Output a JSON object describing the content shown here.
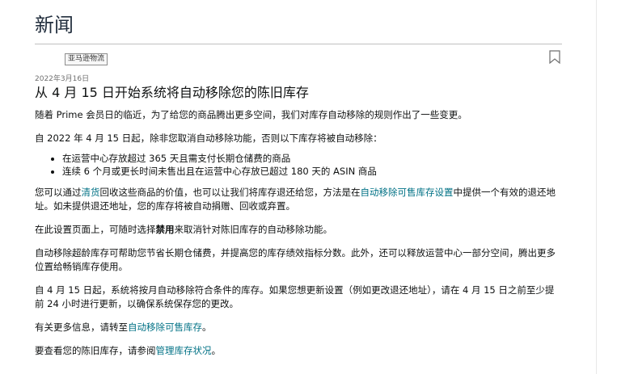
{
  "header": {
    "title": "新闻"
  },
  "article": {
    "tag": "亚马逊物流",
    "date": "2022年3月16日",
    "headline": "从 4 月 15 日开始系统将自动移除您的陈旧库存",
    "p1": "随着 Prime 会员日的临近，为了给您的商品腾出更多空间，我们对库存自动移除的规则作出了一些变更。",
    "p2": "自 2022 年 4 月 15 日起，除非您取消自动移除功能，否则以下库存将被自动移除：",
    "bullets": [
      "在运营中心存放超过 365 天且需支付长期仓储费的商品",
      "连续 6 个月或更长时间未售出且在运营中心存放已超过 180 天的 ASIN 商品"
    ],
    "p3_a": "您可以通过",
    "p3_link1": "清货",
    "p3_b": "回收这些商品的价值，也可以让我们将库存退还给您，方法是在",
    "p3_link2": "自动移除可售库存设置",
    "p3_c": "中提供一个有效的退还地址。如未提供退还地址，您的库存将被自动捐赠、回收或弃置。",
    "p4_a": "在此设置页面上，可随时选择",
    "p4_bold": "禁用",
    "p4_b": "来取消针对陈旧库存的自动移除功能。",
    "p5": "自动移除超龄库存可帮助您节省长期仓储费，并提高您的库存绩效指标分数。此外，还可以释放运营中心一部分空间，腾出更多位置给畅销库存使用。",
    "p6": "自 4 月 15 日起，系统将按月自动移除符合条件的库存。如果您想更新设置（例如更改退还地址），请在 4 月 15 日之前至少提前 24 小时进行更新，以确保系统保存您的更改。",
    "p7_a": "有关更多信息，请转至",
    "p7_link": "自动移除可售库存",
    "p7_b": "。",
    "p8_a": "要查看您的陈旧库存，请参阅",
    "p8_link": "管理库存状况",
    "p8_b": "。"
  },
  "colors": {
    "link": "#007185",
    "title": "#232f3e",
    "text": "#0f1111"
  },
  "icons": {
    "bookmark": "bookmark-icon"
  }
}
